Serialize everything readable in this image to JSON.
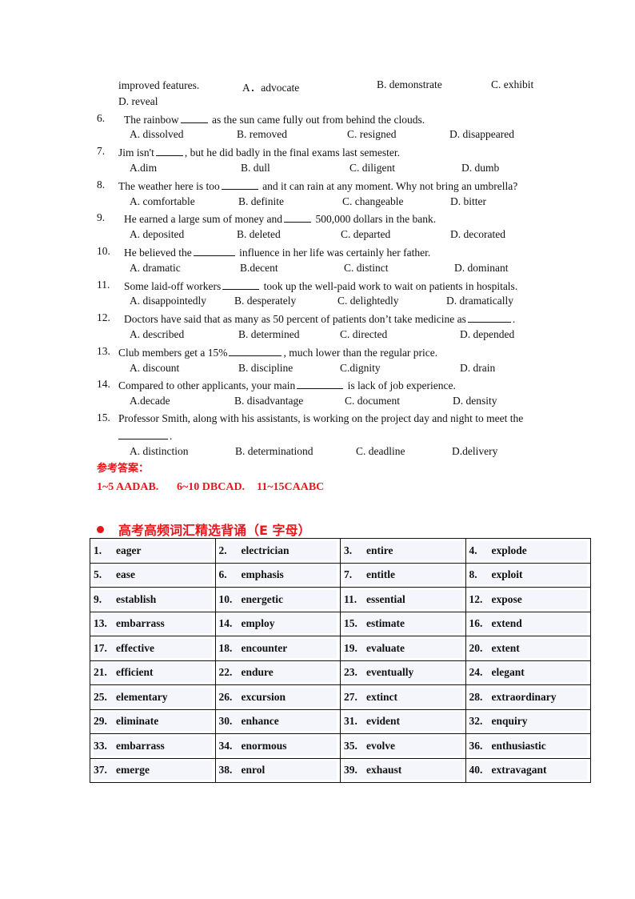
{
  "questions": [
    {
      "id": "q5-cont",
      "number": "",
      "stem_parts": [
        "improved   features."
      ],
      "options": [
        "A．advocate",
        "B.  demonstrate",
        "C.  exhibit",
        "D. reveal"
      ]
    },
    {
      "id": "q6",
      "number": "6.",
      "stem_parts": [
        "The rainbow",
        " as the sun came fully out from behind the clouds."
      ],
      "options": [
        "A. dissolved",
        "B. removed",
        "C. resigned",
        "D. disappeared"
      ]
    },
    {
      "id": "q7",
      "number": "7.",
      "stem_parts": [
        "Jim isn't",
        ", but he did badly in the final exams last semester."
      ],
      "options": [
        "A.dim",
        "B. dull",
        "C. diligent",
        "D. dumb"
      ]
    },
    {
      "id": "q8",
      "number": "8.",
      "stem_parts": [
        "The weather here is too",
        " and it can rain at any moment. Why not bring an umbrella?"
      ],
      "options": [
        "A. comfortable",
        "B. definite",
        "C. changeable",
        "D. bitter"
      ]
    },
    {
      "id": "q9",
      "number": "9.",
      "stem_parts": [
        "He earned a large sum of money and",
        " 500,000 dollars in the bank."
      ],
      "options": [
        "A. deposited",
        "B. deleted",
        "C. departed",
        "D. decorated"
      ]
    },
    {
      "id": "q10",
      "number": "10.",
      "stem_parts": [
        "He believed the",
        " influence in her life was certainly her father."
      ],
      "options": [
        "A. dramatic",
        "B.decent",
        "C. distinct",
        "D. dominant"
      ]
    },
    {
      "id": "q11",
      "number": "11.",
      "stem_parts": [
        "Some laid-off workers",
        " took up the well-paid work to wait on patients in hospitals."
      ],
      "options": [
        "A. disappointedly",
        "B. desperately",
        "C. delightedly",
        "D. dramatically"
      ]
    },
    {
      "id": "q12",
      "number": "12.",
      "stem_parts": [
        "Doctors have said that as many as 50 percent of patients don’t take medicine as",
        "."
      ],
      "options": [
        "A. described",
        "B. determined",
        "C. directed",
        "D. depended"
      ]
    },
    {
      "id": "q13",
      "number": "13.",
      "stem_parts": [
        "Club members get a 15%",
        ", much lower than the regular price."
      ],
      "options": [
        "A. discount",
        "B. discipline",
        "C.dignity",
        "D. drain"
      ]
    },
    {
      "id": "q14",
      "number": "14.",
      "stem_parts": [
        "Compared to other applicants, your main",
        " is lack of job experience."
      ],
      "options": [
        "A.decade",
        "B. disadvantage",
        "C. document",
        "D. density"
      ]
    },
    {
      "id": "q15",
      "number": "15.",
      "stem_parts": [
        "Professor Smith, along with his assistants, is working on the project day and night to meet the",
        "."
      ],
      "options": [
        "A. distinction",
        "B. determinationd",
        "C. deadline",
        "D.delivery"
      ]
    }
  ],
  "answers": {
    "title": "参考答案：",
    "groups": [
      "1~5 AADAB.",
      "6~10 DBCAD.",
      "11~15CAABC"
    ]
  },
  "vocab_section": {
    "title": "高考高频词汇精选背诵（E 字母）",
    "accent_color": "#e8171c",
    "rows": [
      [
        {
          "n": "1.",
          "w": "eager"
        },
        {
          "n": "2.",
          "w": "electrician"
        },
        {
          "n": "3.",
          "w": "entire"
        },
        {
          "n": "4.",
          "w": "explode"
        }
      ],
      [
        {
          "n": "5.",
          "w": "ease"
        },
        {
          "n": "6.",
          "w": "emphasis"
        },
        {
          "n": "7.",
          "w": "entitle"
        },
        {
          "n": "8.",
          "w": "exploit"
        }
      ],
      [
        {
          "n": "9.",
          "w": "establish"
        },
        {
          "n": "10.",
          "w": "energetic"
        },
        {
          "n": "11.",
          "w": "essential"
        },
        {
          "n": "12.",
          "w": "expose"
        }
      ],
      [
        {
          "n": "13.",
          "w": "embarrass"
        },
        {
          "n": "14.",
          "w": "employ"
        },
        {
          "n": "15.",
          "w": "estimate"
        },
        {
          "n": "16.",
          "w": "extend"
        }
      ],
      [
        {
          "n": "17.",
          "w": "effective"
        },
        {
          "n": "18.",
          "w": "encounter"
        },
        {
          "n": "19.",
          "w": "evaluate"
        },
        {
          "n": "20.",
          "w": "extent"
        }
      ],
      [
        {
          "n": "21.",
          "w": "efficient"
        },
        {
          "n": "22.",
          "w": "endure"
        },
        {
          "n": "23.",
          "w": "eventually"
        },
        {
          "n": "24.",
          "w": "elegant"
        }
      ],
      [
        {
          "n": "25.",
          "w": "elementary"
        },
        {
          "n": "26.",
          "w": "excursion"
        },
        {
          "n": "27.",
          "w": "extinct"
        },
        {
          "n": "28.",
          "w": "extraordinary"
        }
      ],
      [
        {
          "n": "29.",
          "w": "eliminate"
        },
        {
          "n": "30.",
          "w": "enhance"
        },
        {
          "n": "31.",
          "w": "evident"
        },
        {
          "n": "32.",
          "w": "enquiry"
        }
      ],
      [
        {
          "n": "33.",
          "w": "embarrass"
        },
        {
          "n": "34.",
          "w": "enormous"
        },
        {
          "n": "35.",
          "w": "evolve"
        },
        {
          "n": "36.",
          "w": "enthusiastic"
        }
      ],
      [
        {
          "n": "37.",
          "w": "emerge"
        },
        {
          "n": "38.",
          "w": "enrol"
        },
        {
          "n": "39.",
          "w": "exhaust"
        },
        {
          "n": "40.",
          "w": "extravagant"
        }
      ]
    ]
  }
}
